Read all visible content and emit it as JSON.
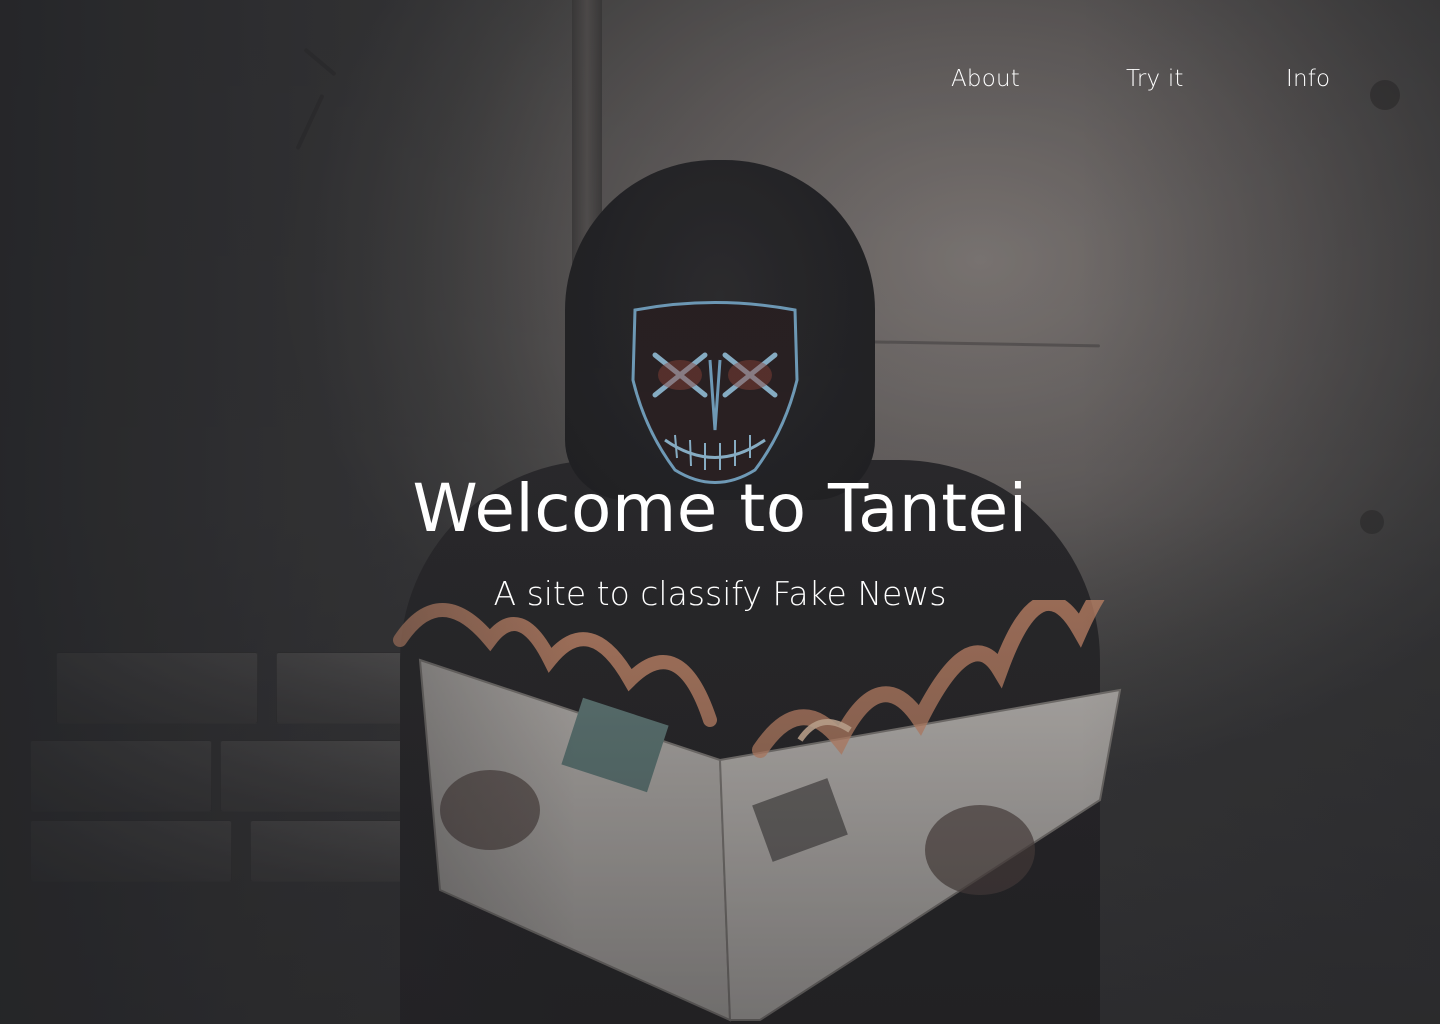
{
  "nav": {
    "items": [
      {
        "label": "About"
      },
      {
        "label": "Try it"
      },
      {
        "label": "Info"
      }
    ]
  },
  "hero": {
    "title": "Welcome to Tantei",
    "subtitle": "A site to classify Fake News",
    "background_image": "hooded-figure-neon-mask-reading-burning-newspaper"
  },
  "colors": {
    "text": "#ffffff",
    "mask_glow": "#7fb4d6",
    "flame": "#f0a27a"
  }
}
